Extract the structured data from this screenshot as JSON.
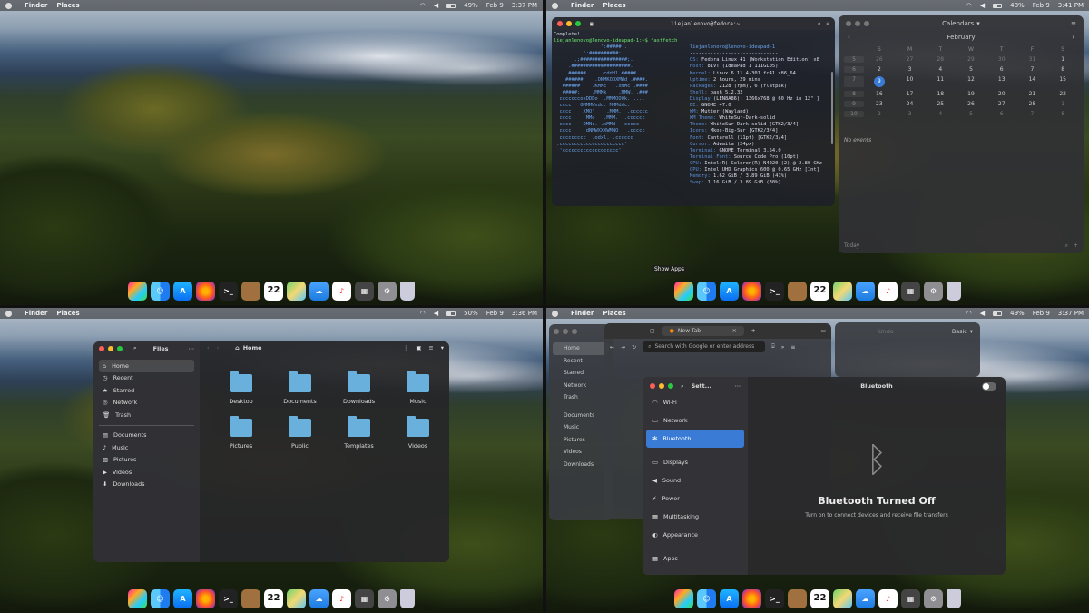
{
  "menubar": {
    "finder": "Finder",
    "places": "Places"
  },
  "q1": {
    "battery": "49%",
    "date": "Feb 9",
    "time": "3:37 PM"
  },
  "q2": {
    "battery": "48%",
    "date": "Feb 9",
    "time": "3:41 PM",
    "dock_tooltip": "Show Apps"
  },
  "q3": {
    "battery": "50%",
    "date": "Feb 9",
    "time": "3:36 PM"
  },
  "q4": {
    "battery": "49%",
    "date": "Feb 9",
    "time": "3:37 PM"
  },
  "dock": {
    "calendar_day": "22",
    "apps": [
      "launchpad",
      "finder",
      "app-store",
      "firefox",
      "terminal",
      "user-folder",
      "calendar",
      "maps",
      "weather",
      "music",
      "calculator",
      "settings",
      "trash"
    ]
  },
  "terminal": {
    "title": "liejanlenovo@fedora:~",
    "lines": [
      "Complete!",
      "liejanlenovo@lenovo-ideapad-1:~$ fastfetch"
    ],
    "art": [
      "                ':#####'.",
      "          ':##########:.",
      "       .;################;.",
      "     .####################.",
      "    .######     .cdddl.#####.",
      "   .######    .ONMKOOXMWd .####.",
      "   ######    .KMMc   .xMMc .####",
      "   #####;    .MMMk    .MMW. .###",
      "  cccccccoxDDDo  .MMMOOOk. ....",
      "  cccc   OMMMWxdd. MMMddc.",
      "  cccc    XMO'    .MMM.  .cccccc",
      "  cccc     MMo   .MMM.  .cccccc",
      "  cccc    OMNc. .xMMd  .ccccc",
      "  cccc     dNMWXXXWMNO   .ccccc",
      "  ccccccccc  .odxl. .cccccc",
      " .cccccccccccccccccccccc'",
      "  'ccccccccccccccccccc'"
    ],
    "header": "liejanlenovo@lenovo-ideapad-1",
    "sep": "------------------------------",
    "info": [
      [
        "OS:",
        "Fedora Linux 41 (Workstation Edition) x8"
      ],
      [
        "Host:",
        "81VT (IdeaPad 1 11IGL05)"
      ],
      [
        "Kernel:",
        "Linux 6.11.4-301.fc41.x86_64"
      ],
      [
        "Uptime:",
        "2 hours, 29 mins"
      ],
      [
        "Packages:",
        "2128 (rpm), 6 (flatpak)"
      ],
      [
        "Shell:",
        "bash 5.2.32"
      ],
      [
        "Display",
        "(LEN8A86): 1366x768 @ 60 Hz in 12\" ]"
      ],
      [
        "DE:",
        "GNOME 47.0"
      ],
      [
        "WM:",
        "Mutter (Wayland)"
      ],
      [
        "WM Theme:",
        "WhiteSur-Dark-solid"
      ],
      [
        "Theme:",
        "WhiteSur-Dark-solid [GTK2/3/4]"
      ],
      [
        "Icons:",
        "Mkos-Big-Sur [GTK2/3/4]"
      ],
      [
        "Font:",
        "Cantarell (11pt) [GTK2/3/4]"
      ],
      [
        "Cursor:",
        "Adwaita (24px)"
      ],
      [
        "Terminal:",
        "GNOME Terminal 3.54.0"
      ],
      [
        "Terminal Font:",
        "Source Code Pro (10pt)"
      ],
      [
        "CPU:",
        "Intel(R) Celeron(R) N4020 (2) @ 2.80 GHz"
      ],
      [
        "GPU:",
        "Intel UHD Graphics 600 @ 0.65 GHz [Int]"
      ],
      [
        "Memory:",
        "1.62 GiB / 3.89 GiB (41%)"
      ],
      [
        "Swap:",
        "1.16 GiB / 3.89 GiB (30%)"
      ]
    ]
  },
  "calendar": {
    "title": "Calendars",
    "month": "February",
    "days": [
      "S",
      "M",
      "T",
      "W",
      "T",
      "F",
      "S"
    ],
    "weeks": [
      {
        "wk": "5",
        "d": [
          "26",
          "27",
          "28",
          "29",
          "30",
          "31",
          "1"
        ]
      },
      {
        "wk": "6",
        "d": [
          "2",
          "3",
          "4",
          "5",
          "6",
          "7",
          "8"
        ]
      },
      {
        "wk": "7",
        "d": [
          "9",
          "10",
          "11",
          "12",
          "13",
          "14",
          "15"
        ]
      },
      {
        "wk": "8",
        "d": [
          "16",
          "17",
          "18",
          "19",
          "20",
          "21",
          "22"
        ]
      },
      {
        "wk": "9",
        "d": [
          "23",
          "24",
          "25",
          "26",
          "27",
          "28",
          "1"
        ]
      },
      {
        "wk": "10",
        "d": [
          "2",
          "3",
          "4",
          "5",
          "6",
          "7",
          "8"
        ]
      }
    ],
    "today": "9",
    "no_events": "No events",
    "today_btn": "Today"
  },
  "files": {
    "title": "Files",
    "path": "Home",
    "sidebar": [
      "Home",
      "Recent",
      "Starred",
      "Network",
      "Trash"
    ],
    "places": [
      "Documents",
      "Music",
      "Pictures",
      "Videos",
      "Downloads"
    ],
    "folders": [
      "Desktop",
      "Documents",
      "Downloads",
      "Music",
      "Pictures",
      "Public",
      "Templates",
      "Videos"
    ]
  },
  "browser": {
    "tab": "New Tab",
    "search_placeholder": "Search with Google or enter address"
  },
  "bg_files": {
    "sidebar": [
      "Home",
      "Recent",
      "Starred",
      "Network",
      "Trash",
      "Documents",
      "Music",
      "Pictures",
      "Videos",
      "Downloads"
    ]
  },
  "calc": {
    "mode": "Basic",
    "undo": "Undo"
  },
  "settings": {
    "title": "Sett...",
    "items": [
      "Wi-Fi",
      "Network",
      "Bluetooth",
      "Displays",
      "Sound",
      "Power",
      "Multitasking",
      "Appearance",
      "Apps"
    ],
    "panel_title": "Bluetooth",
    "status": "Bluetooth Turned Off",
    "hint": "Turn on to connect devices and receive file transfers"
  },
  "colors": {
    "accent": "#3a7bd5",
    "folder": "#6ab0dd"
  }
}
